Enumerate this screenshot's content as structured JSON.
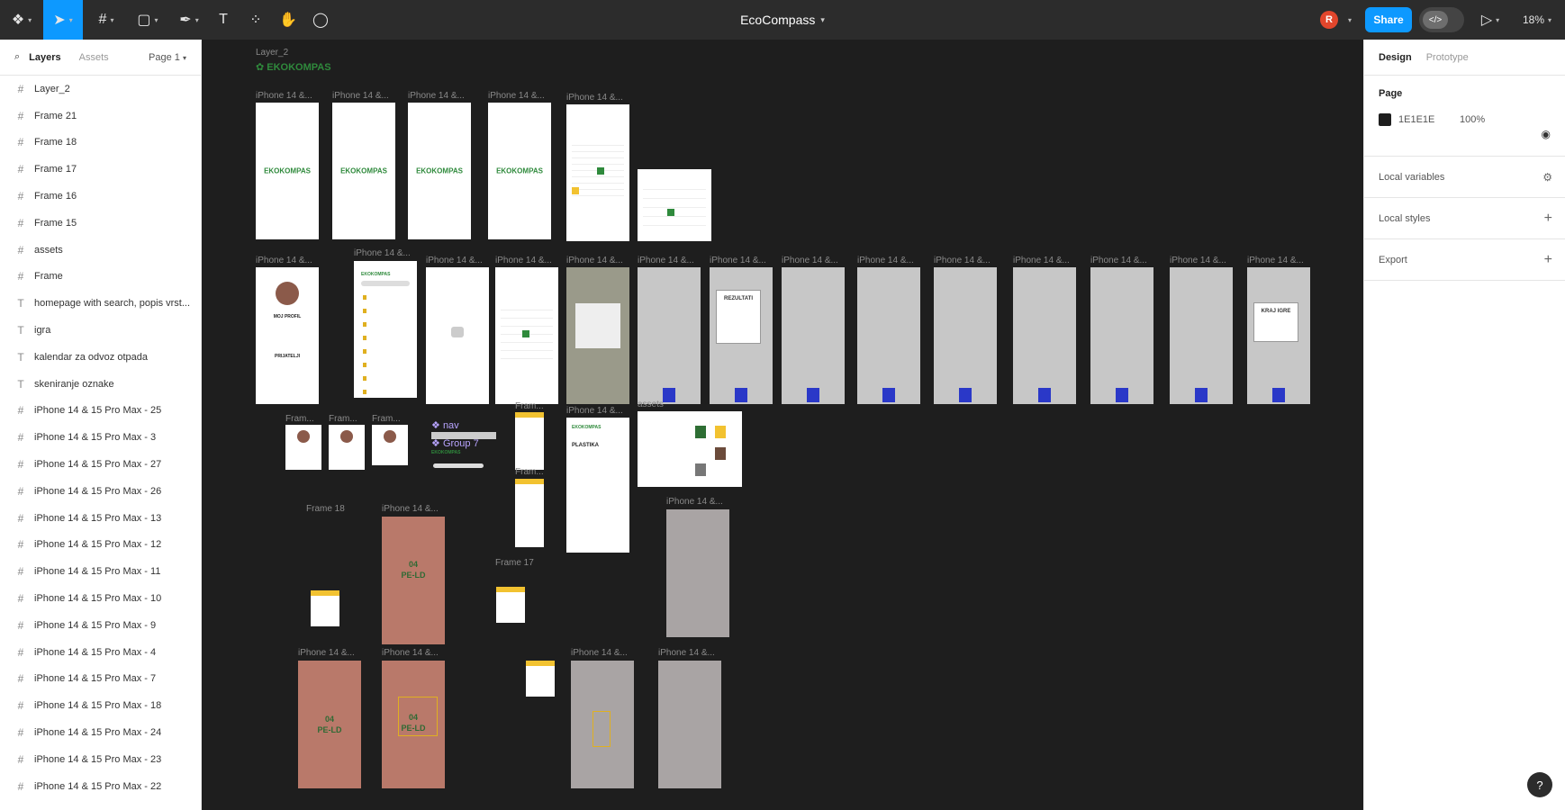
{
  "toolbar": {
    "title": "EcoCompass",
    "avatar_initial": "R",
    "share_label": "Share",
    "zoom": "18%"
  },
  "left_panel": {
    "tabs": [
      "Layers",
      "Assets"
    ],
    "page_selector": "Page 1",
    "layers": [
      {
        "label": "Layer_2",
        "icon": "grid-icon"
      },
      {
        "label": "Frame 21",
        "icon": "frame-icon"
      },
      {
        "label": "Frame 18",
        "icon": "frame-icon"
      },
      {
        "label": "Frame 17",
        "icon": "frame-icon"
      },
      {
        "label": "Frame 16",
        "icon": "frame-icon"
      },
      {
        "label": "Frame 15",
        "icon": "frame-icon"
      },
      {
        "label": "assets",
        "icon": "frame-icon"
      },
      {
        "label": "Frame",
        "icon": "frame-icon"
      },
      {
        "label": "homepage with search, popis vrst...",
        "icon": "text-icon"
      },
      {
        "label": "igra",
        "icon": "text-icon"
      },
      {
        "label": "kalendar za odvoz otpada",
        "icon": "text-icon"
      },
      {
        "label": "skeniranje oznake",
        "icon": "text-icon"
      },
      {
        "label": "iPhone 14 & 15 Pro Max - 25",
        "icon": "frame-icon"
      },
      {
        "label": "iPhone 14 & 15 Pro Max - 3",
        "icon": "frame-icon"
      },
      {
        "label": "iPhone 14 & 15 Pro Max - 27",
        "icon": "frame-icon"
      },
      {
        "label": "iPhone 14 & 15 Pro Max - 26",
        "icon": "frame-icon"
      },
      {
        "label": "iPhone 14 & 15 Pro Max - 13",
        "icon": "frame-icon"
      },
      {
        "label": "iPhone 14 & 15 Pro Max - 12",
        "icon": "frame-icon"
      },
      {
        "label": "iPhone 14 & 15 Pro Max - 11",
        "icon": "frame-icon"
      },
      {
        "label": "iPhone 14 & 15 Pro Max - 10",
        "icon": "frame-icon"
      },
      {
        "label": "iPhone 14 & 15 Pro Max - 9",
        "icon": "frame-icon"
      },
      {
        "label": "iPhone 14 & 15 Pro Max - 4",
        "icon": "frame-icon"
      },
      {
        "label": "iPhone 14 & 15 Pro Max - 7",
        "icon": "frame-icon"
      },
      {
        "label": "iPhone 14 & 15 Pro Max - 18",
        "icon": "frame-icon"
      },
      {
        "label": "iPhone 14 & 15 Pro Max - 24",
        "icon": "frame-icon"
      },
      {
        "label": "iPhone 14 & 15 Pro Max - 23",
        "icon": "frame-icon"
      },
      {
        "label": "iPhone 14 & 15 Pro Max - 22",
        "icon": "frame-icon"
      }
    ]
  },
  "right_panel": {
    "tabs": [
      "Design",
      "Prototype"
    ],
    "page_title": "Page",
    "page_color": "1E1E1E",
    "page_opacity": "100%",
    "sections": [
      "Local variables",
      "Local styles",
      "Export"
    ]
  },
  "canvas": {
    "layer_label": "Layer_2",
    "logo_text": "EKOKOMPAS",
    "iphone_label": "iPhone 14 &...",
    "frame_short": "Fram...",
    "frame_18": "Frame 18",
    "frame_17": "Frame 17",
    "assets": "assets",
    "nav": "nav",
    "group": "Group 7",
    "rezultati": "REZULTATI",
    "kraj_igre": "KRAJ IGRE",
    "moj_profil": "MOJ PROFIL",
    "prijatelji": "PRIJATELJI",
    "plastika": "PLASTIKA",
    "pe_ld_code": "04",
    "pe_ld": "PE-LD"
  },
  "colors": {
    "accent": "#0d99ff",
    "canvas_bg": "#1e1e1e",
    "eco_green": "#2f8a3c"
  }
}
